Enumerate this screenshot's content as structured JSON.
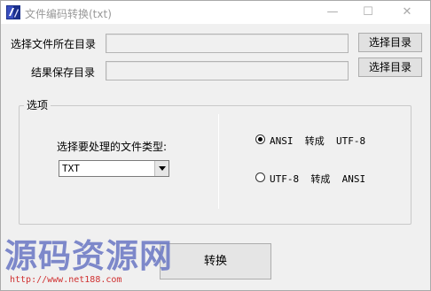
{
  "window": {
    "title": "文件编码转换(txt)",
    "min_symbol": "—",
    "max_symbol": "☐",
    "close_symbol": "✕"
  },
  "source": {
    "label": "选择文件所在目录",
    "value": "",
    "button_label": "选择目录"
  },
  "output": {
    "label": "结果保存目录",
    "value": "",
    "button_label": "选择目录"
  },
  "options": {
    "group_label": "选项",
    "filetype_label": "选择要处理的文件类型:",
    "filetype_selected": "TXT",
    "radio_ansi_to_utf8": {
      "label": "ANSI  转成  UTF-8",
      "checked": true
    },
    "radio_utf8_to_ansi": {
      "label": "UTF-8  转成  ANSI",
      "checked": false
    }
  },
  "actions": {
    "convert_label": "转换"
  },
  "watermark": {
    "text": "源码资源网",
    "url": "http://www.net188.com"
  }
}
